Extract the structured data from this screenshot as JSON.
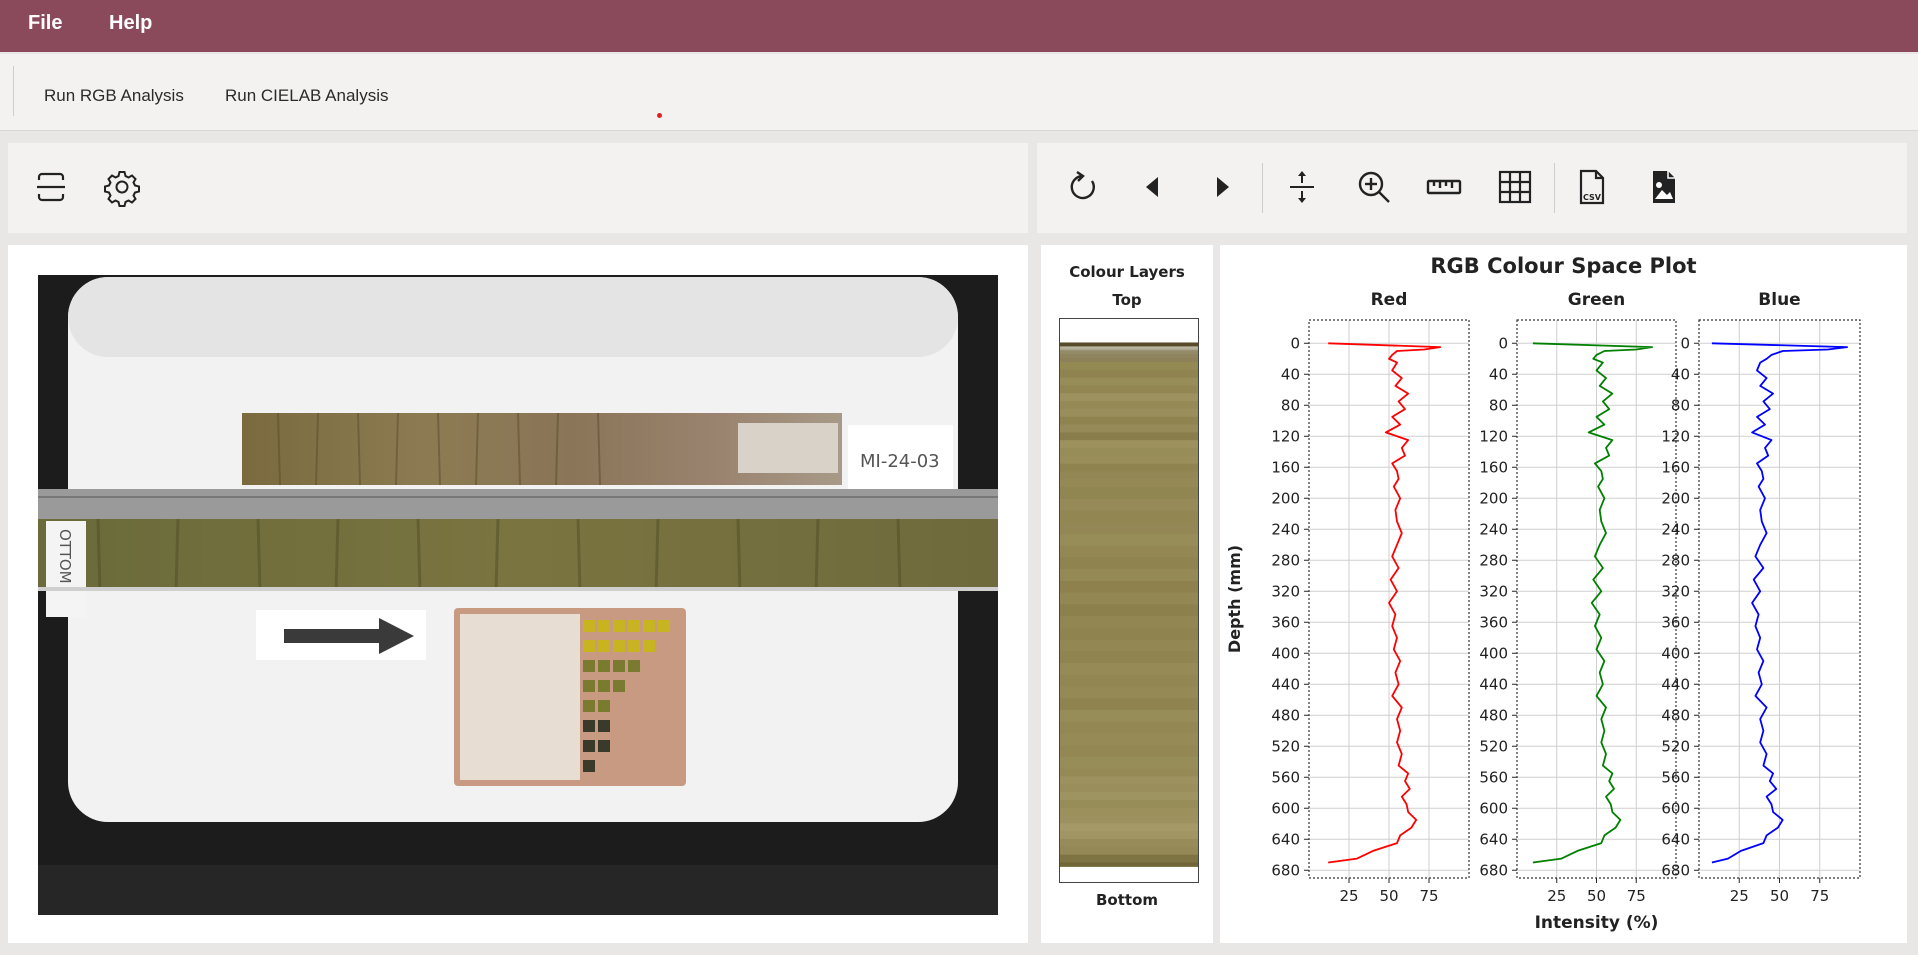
{
  "menu": {
    "file": "File",
    "help": "Help"
  },
  "toolbar": {
    "rgb_button": "Run RGB Analysis",
    "cielab_button": "Run CIELAB Analysis"
  },
  "left_tools": [
    {
      "icon": "scanner-icon"
    },
    {
      "icon": "gear-icon"
    }
  ],
  "right_tools": [
    {
      "icon": "reset-icon"
    },
    {
      "icon": "previous-icon"
    },
    {
      "icon": "next-icon"
    },
    {
      "icon": "resize-vertical-icon"
    },
    {
      "icon": "zoom-icon"
    },
    {
      "icon": "ruler-icon"
    },
    {
      "icon": "grid-icon"
    },
    {
      "icon": "csv-export-icon"
    },
    {
      "icon": "image-export-icon"
    }
  ],
  "photo": {
    "sample_label": "MI-24-03",
    "side_label": "OTTOM"
  },
  "colour_layers": {
    "title": "Colour Layers",
    "top": "Top",
    "bottom": "Bottom"
  },
  "chart_data": {
    "type": "line",
    "title": "RGB Colour Space Plot",
    "ylabel": "Depth (mm)",
    "xlabel": "Intensity (%)",
    "y_ticks": [
      0,
      40,
      80,
      120,
      160,
      200,
      240,
      280,
      320,
      360,
      400,
      440,
      480,
      520,
      560,
      600,
      640,
      680
    ],
    "x_ticks": [
      25,
      50,
      75
    ],
    "xlim": [
      0,
      100
    ],
    "ylim": [
      690,
      -30
    ],
    "grid": true,
    "series": [
      {
        "name": "Red",
        "color": "#ff0000",
        "depth": [
          0,
          5,
          8,
          10,
          15,
          20,
          25,
          35,
          45,
          55,
          65,
          75,
          85,
          95,
          105,
          115,
          125,
          135,
          145,
          155,
          165,
          175,
          185,
          200,
          215,
          230,
          245,
          260,
          275,
          290,
          305,
          320,
          335,
          350,
          365,
          380,
          395,
          410,
          425,
          440,
          455,
          470,
          485,
          500,
          515,
          530,
          545,
          555,
          565,
          575,
          585,
          595,
          605,
          615,
          625,
          635,
          645,
          655,
          665,
          670
        ],
        "values": [
          12,
          82,
          72,
          55,
          52,
          50,
          55,
          52,
          58,
          54,
          62,
          56,
          60,
          52,
          57,
          48,
          62,
          58,
          60,
          52,
          55,
          56,
          53,
          57,
          54,
          55,
          58,
          55,
          52,
          56,
          51,
          55,
          50,
          54,
          52,
          55,
          53,
          57,
          54,
          56,
          52,
          58,
          55,
          57,
          55,
          58,
          56,
          62,
          60,
          63,
          58,
          61,
          62,
          67,
          64,
          57,
          55,
          40,
          30,
          12
        ]
      },
      {
        "name": "Green",
        "color": "#008000",
        "depth": [
          0,
          5,
          8,
          10,
          15,
          20,
          25,
          35,
          45,
          55,
          65,
          75,
          85,
          95,
          105,
          115,
          125,
          135,
          145,
          155,
          165,
          175,
          185,
          200,
          215,
          230,
          245,
          260,
          275,
          290,
          305,
          320,
          335,
          350,
          365,
          380,
          395,
          410,
          425,
          440,
          455,
          470,
          485,
          500,
          515,
          530,
          545,
          555,
          565,
          575,
          585,
          595,
          605,
          615,
          625,
          635,
          645,
          655,
          665,
          670
        ],
        "values": [
          10,
          85,
          75,
          55,
          50,
          48,
          54,
          50,
          56,
          52,
          60,
          54,
          58,
          50,
          55,
          45,
          60,
          56,
          58,
          49,
          53,
          54,
          51,
          55,
          52,
          53,
          56,
          52,
          49,
          54,
          48,
          53,
          47,
          52,
          49,
          53,
          50,
          55,
          52,
          54,
          50,
          56,
          53,
          55,
          53,
          56,
          54,
          60,
          58,
          61,
          56,
          59,
          60,
          65,
          62,
          55,
          53,
          38,
          28,
          10
        ]
      },
      {
        "name": "Blue",
        "color": "#0000ff",
        "depth": [
          0,
          5,
          8,
          10,
          15,
          20,
          25,
          35,
          45,
          55,
          65,
          75,
          85,
          95,
          105,
          115,
          125,
          135,
          145,
          155,
          165,
          175,
          185,
          200,
          215,
          230,
          245,
          260,
          275,
          290,
          305,
          320,
          335,
          350,
          365,
          380,
          395,
          410,
          425,
          440,
          455,
          470,
          485,
          500,
          515,
          530,
          545,
          555,
          565,
          575,
          585,
          595,
          605,
          615,
          625,
          635,
          645,
          655,
          665,
          670
        ],
        "values": [
          8,
          92,
          80,
          52,
          45,
          42,
          38,
          36,
          42,
          38,
          46,
          40,
          44,
          36,
          41,
          33,
          45,
          41,
          43,
          36,
          39,
          40,
          37,
          41,
          38,
          39,
          42,
          38,
          35,
          40,
          34,
          38,
          33,
          37,
          35,
          38,
          36,
          40,
          37,
          39,
          35,
          42,
          38,
          40,
          38,
          42,
          40,
          46,
          44,
          48,
          42,
          45,
          46,
          52,
          49,
          42,
          40,
          26,
          18,
          8
        ]
      }
    ]
  }
}
